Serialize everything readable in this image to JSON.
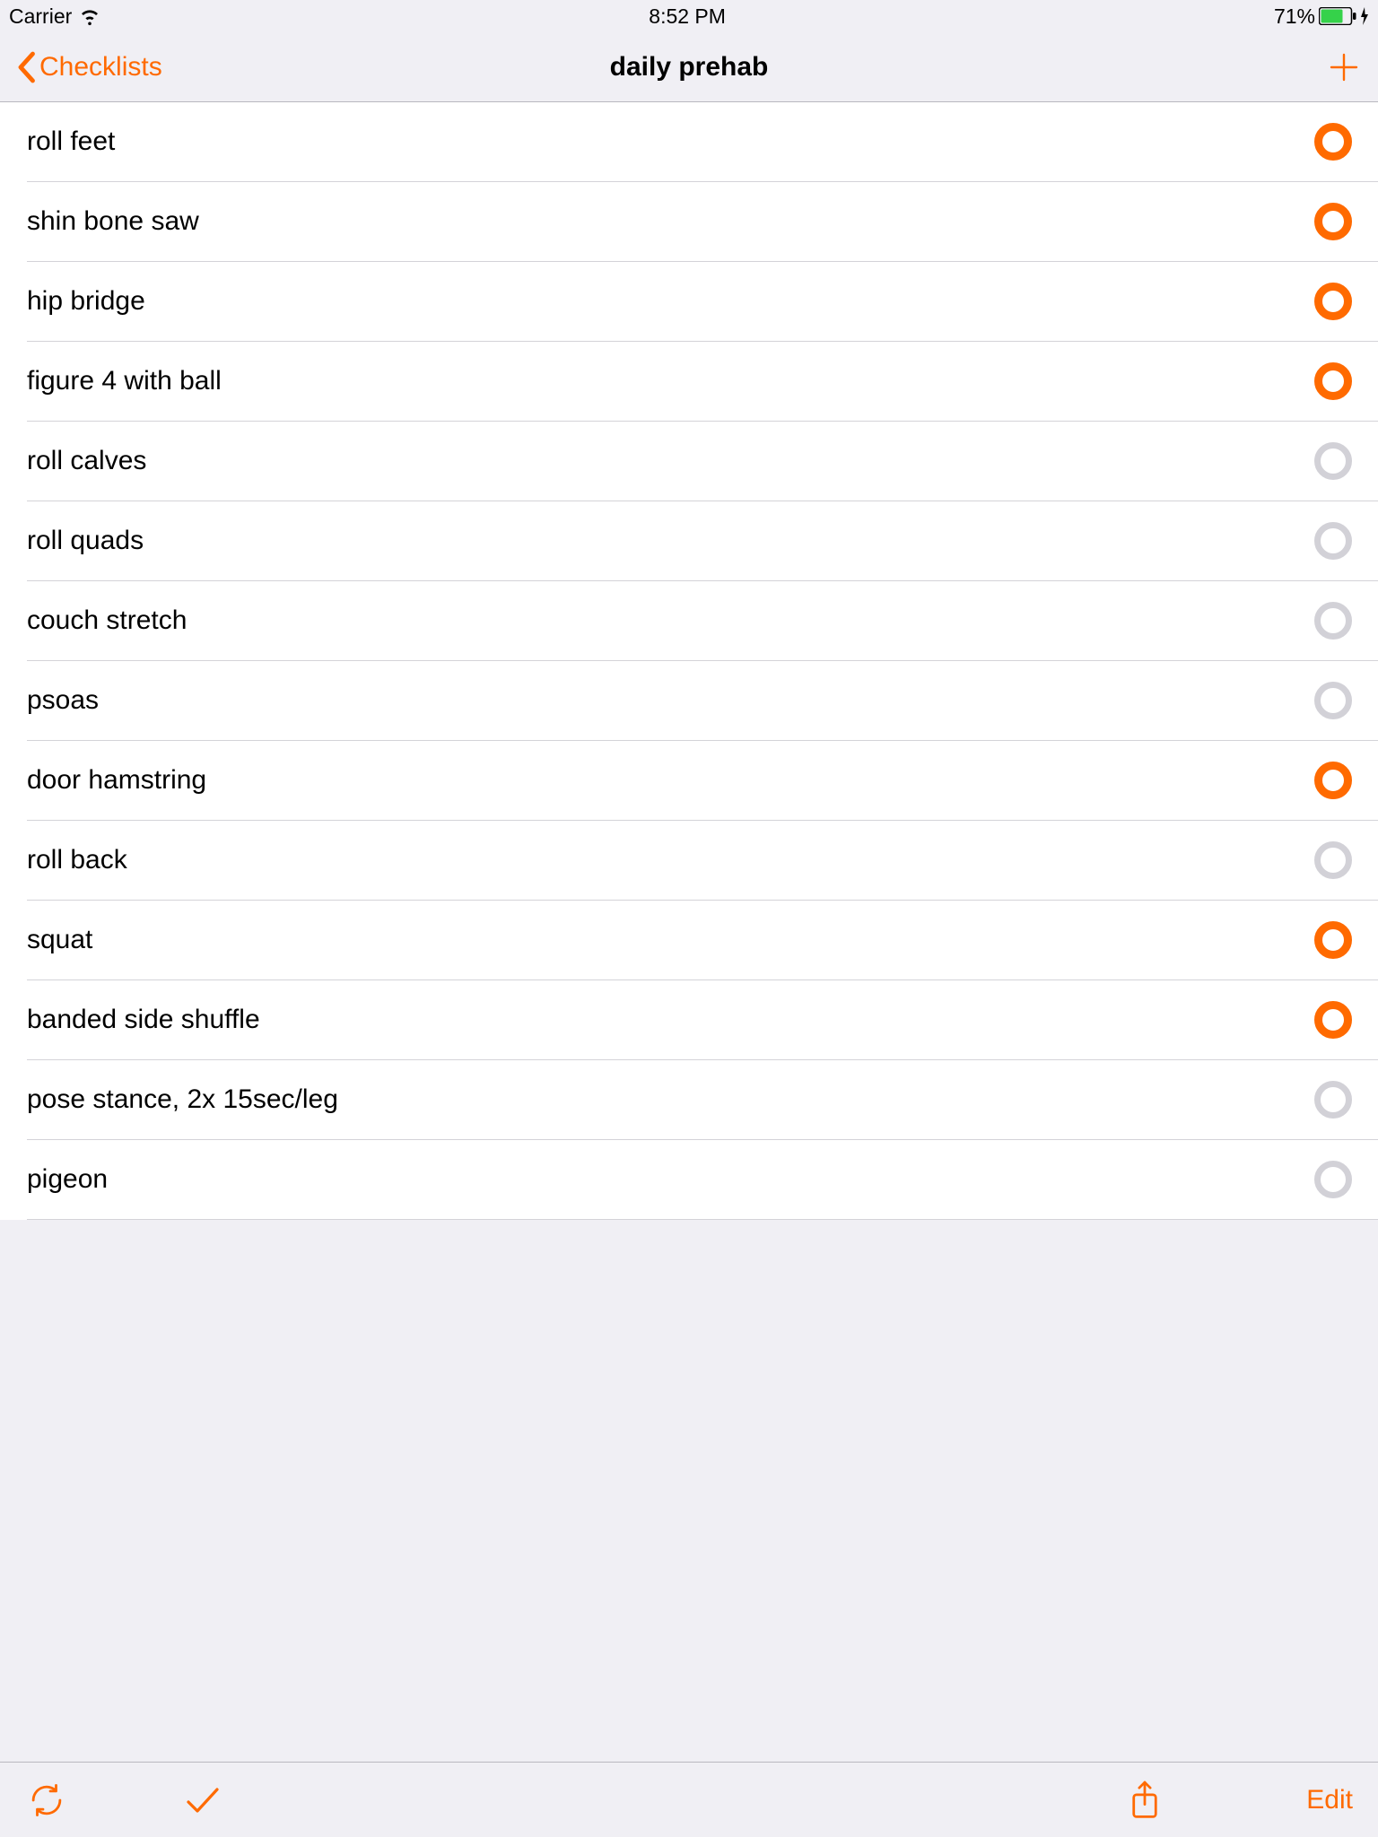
{
  "statusbar": {
    "carrier": "Carrier",
    "time": "8:52 PM",
    "battery_percent": "71%"
  },
  "nav": {
    "back_label": "Checklists",
    "title": "daily prehab"
  },
  "colors": {
    "accent": "#ff6a00",
    "unchecked": "#d2d1d7",
    "hairline": "#d4d3d8"
  },
  "items": [
    {
      "label": "roll feet",
      "checked": true
    },
    {
      "label": "shin bone saw",
      "checked": true
    },
    {
      "label": "hip bridge",
      "checked": true
    },
    {
      "label": "figure 4 with ball",
      "checked": true
    },
    {
      "label": "roll calves",
      "checked": false
    },
    {
      "label": "roll quads",
      "checked": false
    },
    {
      "label": "couch stretch",
      "checked": false
    },
    {
      "label": "psoas",
      "checked": false
    },
    {
      "label": "door hamstring",
      "checked": true
    },
    {
      "label": "roll back",
      "checked": false
    },
    {
      "label": "squat",
      "checked": true
    },
    {
      "label": "banded side shuffle",
      "checked": true
    },
    {
      "label": "pose stance, 2x 15sec/leg",
      "checked": false
    },
    {
      "label": "pigeon",
      "checked": false
    }
  ],
  "toolbar": {
    "edit_label": "Edit"
  }
}
